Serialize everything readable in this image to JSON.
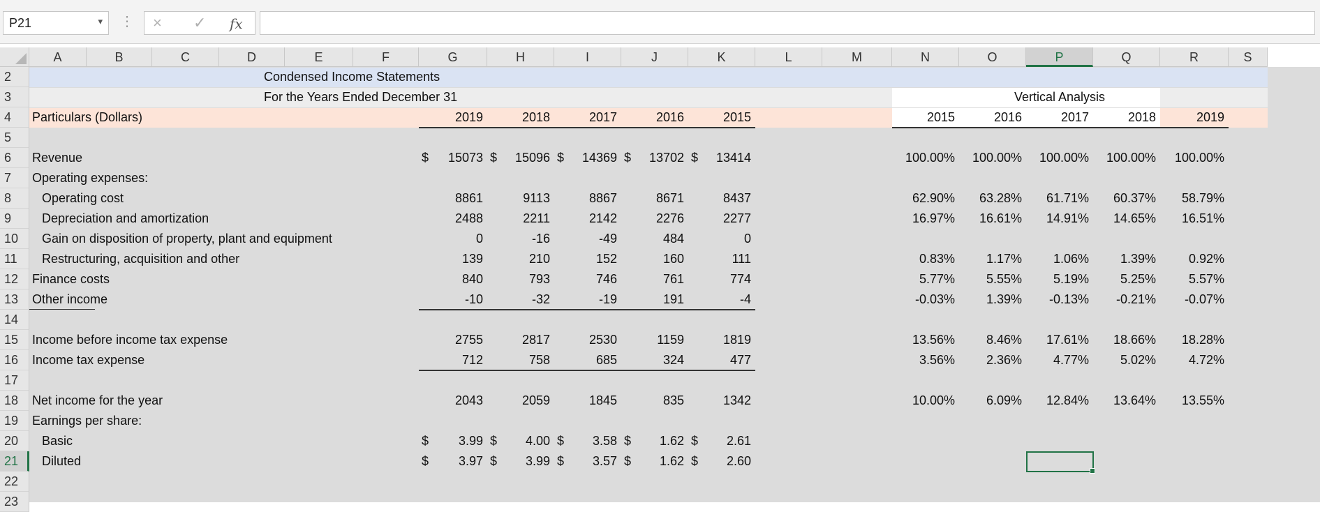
{
  "formula_bar": {
    "name_box": "P21",
    "name_box_dropdown": "chevron-down-icon",
    "cancel_icon": "×",
    "enter_icon": "✓",
    "fx_label": "fx",
    "formula": ""
  },
  "columns": [
    "A",
    "B",
    "C",
    "D",
    "E",
    "F",
    "G",
    "H",
    "I",
    "J",
    "K",
    "L",
    "M",
    "N",
    "O",
    "P",
    "Q",
    "R",
    "S"
  ],
  "rows": [
    "2",
    "3",
    "4",
    "5",
    "6",
    "7",
    "8",
    "9",
    "10",
    "11",
    "12",
    "13",
    "14",
    "15",
    "16",
    "17",
    "18",
    "19",
    "20",
    "21",
    "22",
    "23"
  ],
  "sheet": {
    "title": "Condensed Income Statements",
    "subtitle": "For the Years Ended December 31",
    "particulars_header": "Particulars (Dollars)",
    "years": [
      "2019",
      "2018",
      "2017",
      "2016",
      "2015"
    ],
    "vertical_analysis": {
      "title": "Vertical Analysis",
      "years": [
        "2015",
        "2016",
        "2017",
        "2018",
        "2019"
      ]
    },
    "dollar_sign": "$",
    "line_items": [
      {
        "row": "6",
        "label": "Revenue",
        "indent": false,
        "currency": true,
        "values": [
          "15073",
          "15096",
          "14369",
          "13702",
          "13414"
        ],
        "va": [
          "100.00%",
          "100.00%",
          "100.00%",
          "100.00%",
          "100.00%"
        ]
      },
      {
        "row": "7",
        "label": "Operating expenses:",
        "indent": false,
        "currency": false,
        "values": [
          "",
          "",
          "",
          "",
          ""
        ],
        "va": [
          "",
          "",
          "",
          "",
          ""
        ]
      },
      {
        "row": "8",
        "label": "Operating cost",
        "indent": true,
        "currency": false,
        "values": [
          "8861",
          "9113",
          "8867",
          "8671",
          "8437"
        ],
        "va": [
          "62.90%",
          "63.28%",
          "61.71%",
          "60.37%",
          "58.79%"
        ]
      },
      {
        "row": "9",
        "label": "Depreciation and amortization",
        "indent": true,
        "currency": false,
        "values": [
          "2488",
          "2211",
          "2142",
          "2276",
          "2277"
        ],
        "va": [
          "16.97%",
          "16.61%",
          "14.91%",
          "14.65%",
          "16.51%"
        ]
      },
      {
        "row": "10",
        "label": "Gain on disposition of property, plant and equipment",
        "indent": true,
        "currency": false,
        "values": [
          "0",
          "-16",
          "-49",
          "484",
          "0"
        ],
        "va": [
          "",
          "",
          "",
          "",
          ""
        ]
      },
      {
        "row": "11",
        "label": "Restructuring, acquisition and other",
        "indent": true,
        "currency": false,
        "values": [
          "139",
          "210",
          "152",
          "160",
          "111"
        ],
        "va": [
          "0.83%",
          "1.17%",
          "1.06%",
          "1.39%",
          "0.92%"
        ]
      },
      {
        "row": "12",
        "label": "Finance costs",
        "indent": false,
        "currency": false,
        "values": [
          "840",
          "793",
          "746",
          "761",
          "774"
        ],
        "va": [
          "5.77%",
          "5.55%",
          "5.19%",
          "5.25%",
          "5.57%"
        ]
      },
      {
        "row": "13",
        "label": "Other income",
        "indent": false,
        "currency": false,
        "values": [
          "-10",
          "-32",
          "-19",
          "191",
          "-4"
        ],
        "va": [
          "-0.03%",
          "1.39%",
          "-0.13%",
          "-0.21%",
          "-0.07%"
        ]
      },
      {
        "row": "15",
        "label": "Income before income tax expense",
        "indent": false,
        "currency": false,
        "values": [
          "2755",
          "2817",
          "2530",
          "1159",
          "1819"
        ],
        "va": [
          "13.56%",
          "8.46%",
          "17.61%",
          "18.66%",
          "18.28%"
        ]
      },
      {
        "row": "16",
        "label": "Income tax expense",
        "indent": false,
        "currency": false,
        "values": [
          "712",
          "758",
          "685",
          "324",
          "477"
        ],
        "va": [
          "3.56%",
          "2.36%",
          "4.77%",
          "5.02%",
          "4.72%"
        ]
      },
      {
        "row": "18",
        "label": "Net income for the year",
        "indent": false,
        "currency": false,
        "values": [
          "2043",
          "2059",
          "1845",
          "835",
          "1342"
        ],
        "va": [
          "10.00%",
          "6.09%",
          "12.84%",
          "13.64%",
          "13.55%"
        ]
      },
      {
        "row": "19",
        "label": "Earnings per share:",
        "indent": false,
        "currency": false,
        "values": [
          "",
          "",
          "",
          "",
          ""
        ],
        "va": [
          "",
          "",
          "",
          "",
          ""
        ]
      },
      {
        "row": "20",
        "label": "Basic",
        "indent": true,
        "currency": true,
        "values": [
          "3.99",
          "4.00",
          "3.58",
          "1.62",
          "2.61"
        ],
        "va": [
          "",
          "",
          "",
          "",
          ""
        ]
      },
      {
        "row": "21",
        "label": "Diluted",
        "indent": true,
        "currency": true,
        "values": [
          "3.97",
          "3.99",
          "3.57",
          "1.62",
          "2.60"
        ],
        "va": [
          "",
          "",
          "",
          "",
          ""
        ]
      }
    ]
  },
  "colors": {
    "title_band": "#dae3f3",
    "subtitle_band": "#ededed",
    "header_band": "#fde4d8",
    "selection": "#217346"
  }
}
